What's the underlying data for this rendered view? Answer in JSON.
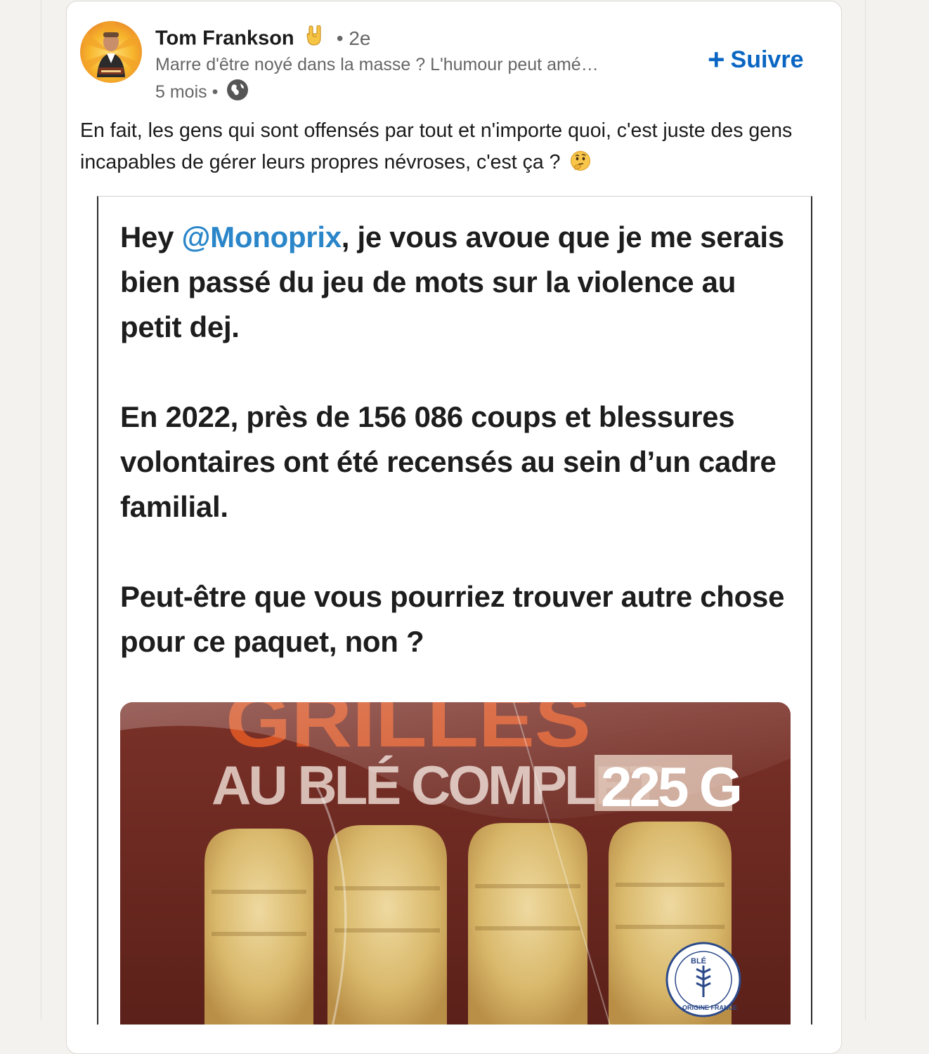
{
  "post": {
    "author": {
      "name": "Tom Frankson",
      "name_emoji": "rock-hand-icon",
      "degree": "• 2e",
      "headline": "Marre d'être noyé dans la masse ? L'humour peut amé…",
      "time": "5 mois •",
      "visibility_icon": "globe-icon"
    },
    "follow": {
      "plus": "+",
      "label": "Suivre"
    },
    "text": "En fait, les gens qui sont offensés par tout et n'importe quoi, c'est juste des gens incapables de gérer leurs propres névroses, c'est ça ?",
    "text_emoji": "thinking-face-icon"
  },
  "media": {
    "p1_a": "Hey ",
    "p1_mention": "@Monoprix",
    "p1_b": ", je vous avoue que je me serais bien passé du jeu de mots sur la violence au petit dej.",
    "p2": "En 2022, près de 156 086 coups et blessures volontaires ont été recensés au sein d’un cadre familial.",
    "p3": "Peut-être que vous pourriez trouver autre chose pour ce paquet, non ?",
    "package": {
      "brand_partial": "GRILLÉS",
      "subtitle": "AU BLÉ COMPLET",
      "weight": "225 G",
      "badge_top": "BLÉ",
      "badge_bottom": "ORIGINE FRANCE"
    }
  },
  "colors": {
    "link_blue": "#0a66c2",
    "mention_blue": "#2a86c9",
    "package_brown": "#6a2a22",
    "package_orange": "#e45a25"
  }
}
